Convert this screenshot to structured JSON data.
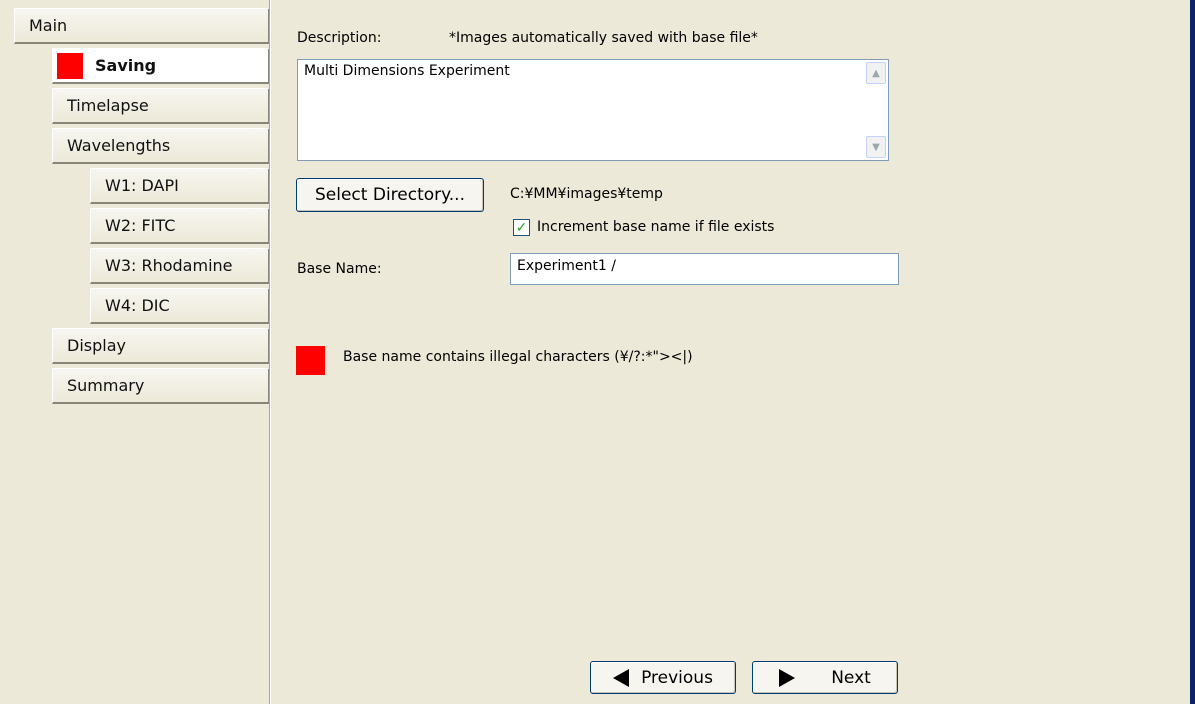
{
  "sidebar": {
    "main_label": "Main",
    "items": [
      {
        "label": "Saving"
      },
      {
        "label": "Timelapse"
      },
      {
        "label": "Wavelengths"
      },
      {
        "label": "W1: DAPI"
      },
      {
        "label": "W2: FITC"
      },
      {
        "label": "W3: Rhodamine"
      },
      {
        "label": "W4: DIC"
      },
      {
        "label": "Display"
      },
      {
        "label": "Summary"
      }
    ]
  },
  "form": {
    "description_label": "Description:",
    "description_note": "*Images automatically saved with base file*",
    "description_value": "Multi Dimensions Experiment",
    "select_directory_label": "Select Directory...",
    "directory_path": "C:¥MM¥images¥temp",
    "increment_label": "Increment base name if file exists",
    "increment_checked": true,
    "base_name_label": "Base Name:",
    "base_name_value": "Experiment1 /",
    "error_message": "Base name contains illegal characters (¥/?:*\"><|)"
  },
  "nav": {
    "previous_label": "Previous",
    "next_label": "Next"
  },
  "colors": {
    "indicator": "#ff0000",
    "background": "#ece9d8",
    "check": "#21a121"
  }
}
